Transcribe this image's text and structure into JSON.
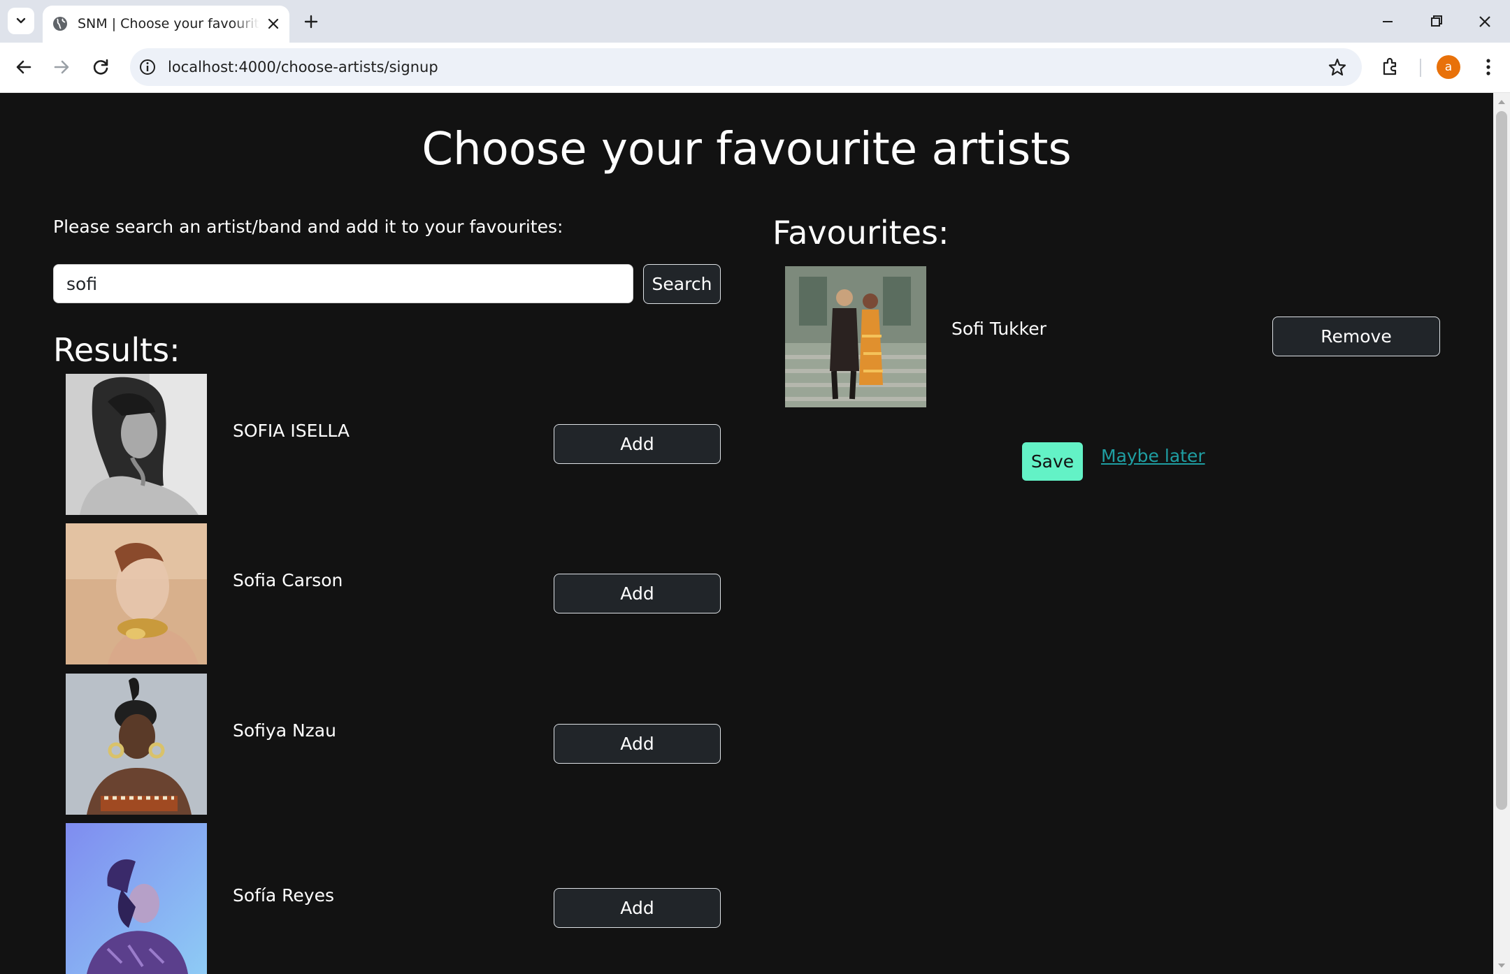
{
  "browser": {
    "tab_title": "SNM | Choose your favourite artists",
    "url": "localhost:4000/choose-artists/signup",
    "profile_initial": "a"
  },
  "page": {
    "title": "Choose your favourite artists",
    "prompt": "Please search an artist/band and add it to your favourites:",
    "search": {
      "value": "sofi",
      "button_label": "Search"
    },
    "results_heading": "Results:",
    "results": [
      {
        "name": "SOFIA ISELLA",
        "button_label": "Add"
      },
      {
        "name": "Sofia Carson",
        "button_label": "Add"
      },
      {
        "name": "Sofiya Nzau",
        "button_label": "Add"
      },
      {
        "name": "Sofía Reyes",
        "button_label": "Add"
      }
    ],
    "favourites_heading": "Favourites:",
    "favourites": [
      {
        "name": "Sofi Tukker",
        "button_label": "Remove"
      }
    ],
    "save_label": "Save",
    "maybe_later_label": "Maybe later"
  },
  "colors": {
    "page_background": "#121212",
    "button_background": "#212529",
    "save_accent": "#63f2c6",
    "link": "#1f9ea2",
    "avatar": "#e8710a"
  }
}
